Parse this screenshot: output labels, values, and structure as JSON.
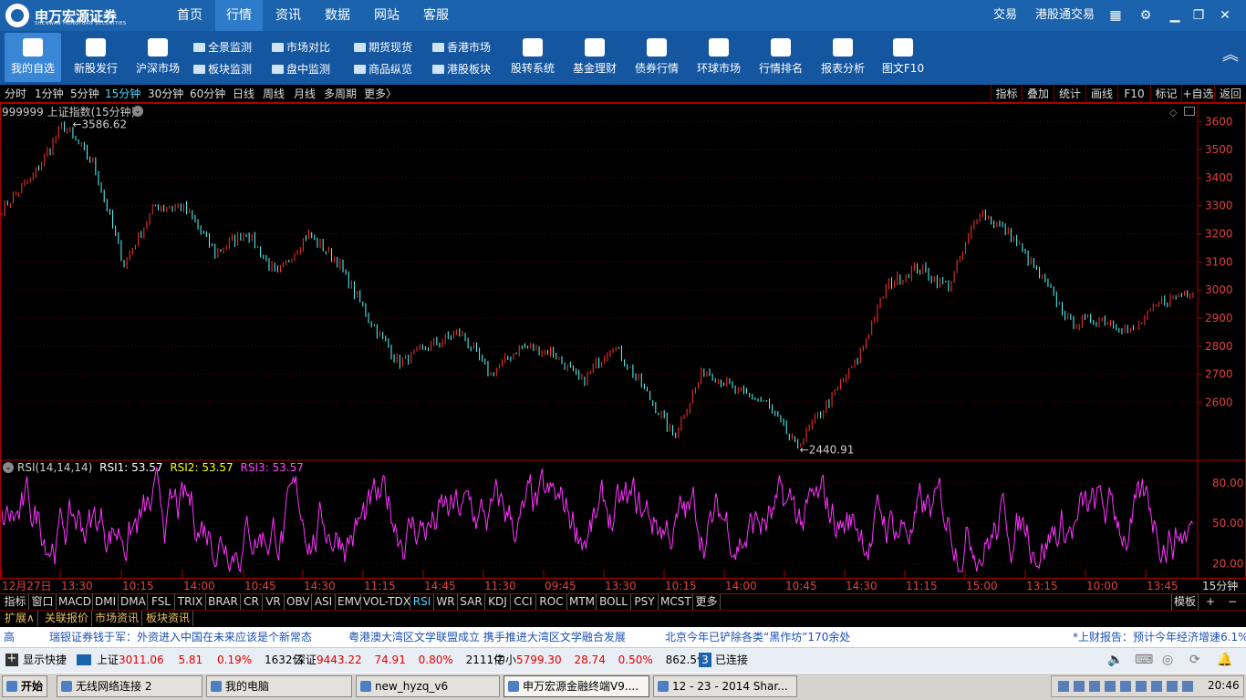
{
  "app": {
    "logo_text": "申万宏源证券",
    "logo_sub": "SHENWAN HONGYUAN SECURITIES"
  },
  "nav": [
    "首页",
    "行情",
    "资讯",
    "数据",
    "网站",
    "客服"
  ],
  "nav_active": 1,
  "top_right": [
    "交易",
    "港股通交易"
  ],
  "toolbar": {
    "big_left": [
      "我的自选",
      "新股发行",
      "沪深市场"
    ],
    "small": [
      [
        "全景监测",
        "板块监测"
      ],
      [
        "市场对比",
        "盘中监测"
      ],
      [
        "期货现货",
        "商品纵览"
      ],
      [
        "香港市场",
        "港股板块"
      ]
    ],
    "big_right": [
      "股转系统",
      "基金理财",
      "债券行情",
      "环球市场",
      "行情排名",
      "报表分析",
      "图文F10"
    ]
  },
  "periods": [
    "分时",
    "1分钟",
    "5分钟",
    "15分钟",
    "30分钟",
    "60分钟",
    "日线",
    "周线",
    "月线",
    "多周期",
    "更多〉"
  ],
  "period_active": 3,
  "right_tools": [
    "指标",
    "叠加",
    "统计",
    "画线",
    "F10",
    "标记",
    "+自选",
    "返回"
  ],
  "chart_data": {
    "type": "line",
    "title": "999999 上证指数(15分钟)",
    "y_ticks": [
      3600,
      3500,
      3400,
      3300,
      3200,
      3100,
      3000,
      2900,
      2800,
      2700,
      2600
    ],
    "ylim": [
      2400,
      3640
    ],
    "high_label": "3586.62",
    "low_label": "2440.91",
    "x_labels": [
      "12月27日",
      "13:30",
      "10:15",
      "14:00",
      "10:45",
      "14:30",
      "11:15",
      "14:45",
      "11:30",
      "09:45",
      "13:30",
      "10:15",
      "14:00",
      "10:45",
      "14:30",
      "11:15",
      "15:00",
      "13:15",
      "10:00",
      "13:45"
    ],
    "x_right_label": "15分钟",
    "price_anchors": [
      3290,
      3400,
      3586,
      3450,
      3090,
      3300,
      3290,
      3130,
      3210,
      3050,
      3200,
      3100,
      2900,
      2740,
      2800,
      2850,
      2700,
      2800,
      2780,
      2670,
      2810,
      2650,
      2480,
      2720,
      2640,
      2600,
      2440,
      2590,
      2750,
      3020,
      3080,
      3010,
      3280,
      3200,
      3050,
      2880,
      2900,
      2850,
      2960,
      3000
    ],
    "indicator": {
      "name": "RSI(14,14,14)",
      "series": [
        {
          "name": "RSI1",
          "value": "53.57",
          "color": "#ffffff"
        },
        {
          "name": "RSI2",
          "value": "53.57",
          "color": "#ffff00"
        },
        {
          "name": "RSI3",
          "value": "53.57",
          "color": "#ff44ff"
        }
      ],
      "y_ticks": [
        "80.00",
        "50.00",
        "20.00"
      ],
      "ylim": [
        10,
        95
      ]
    }
  },
  "indicator_tabs": [
    "指标",
    "窗口",
    "MACD",
    "DMI",
    "DMA",
    "FSL",
    "TRIX",
    "BRAR",
    "CR",
    "VR",
    "OBV",
    "ASI",
    "EMV",
    "VOL-TDX",
    "RSI",
    "WR",
    "SAR",
    "KDJ",
    "CCI",
    "ROC",
    "MTM",
    "BOLL",
    "PSY",
    "MCST",
    "更多"
  ],
  "indicator_active": 14,
  "indicator_right": [
    "模板",
    "+",
    "−"
  ],
  "info_tabs": [
    "扩展∧",
    "关联报价",
    "市场资讯",
    "板块资讯"
  ],
  "ticker": [
    "高",
    "瑞银证券钱于军：外资进入中国在未来应该是个新常态",
    "粤港澳大湾区文学联盟成立 携手推进大湾区文学融合发展",
    "北京今年已铲除各类“黑作坊”170余处",
    "*上财报告：预计今年经济增速6.1%"
  ],
  "status": {
    "shortcut": "显示快捷",
    "sh": {
      "name": "上证",
      "price": "3011.06",
      "chg": "5.81",
      "pct": "0.19%",
      "vol": "1632亿"
    },
    "sz": {
      "name": "深证",
      "price": "9443.22",
      "chg": "74.91",
      "pct": "0.80%",
      "vol": "2111亿"
    },
    "zx": {
      "name": "中小",
      "price": "5799.30",
      "chg": "28.74",
      "pct": "0.50%",
      "vol": "862.5亿"
    },
    "conn_num": "3",
    "conn": "已连接"
  },
  "taskbar": {
    "start": "开始",
    "tasks": [
      "无线网络连接 2",
      "我的电脑",
      "new_hyzq_v6",
      "申万宏源金融终端V9....",
      "12 - 23 - 2014 Shar..."
    ],
    "time": "20:46"
  }
}
